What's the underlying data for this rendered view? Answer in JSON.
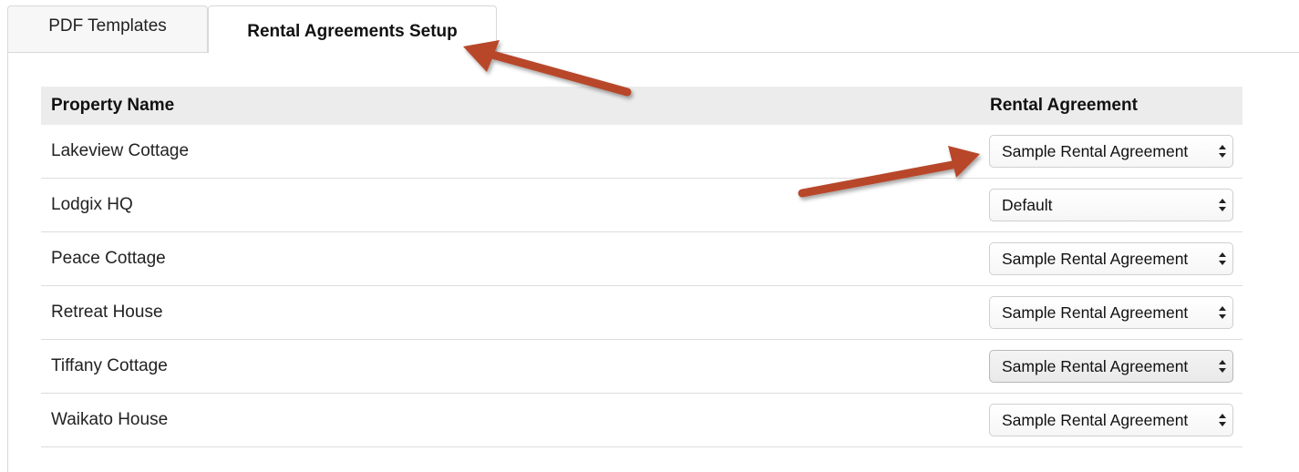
{
  "tabs": [
    {
      "label": "PDF Templates",
      "active": false
    },
    {
      "label": "Rental Agreements Setup",
      "active": true
    }
  ],
  "table": {
    "headers": {
      "property_name": "Property Name",
      "rental_agreement": "Rental Agreement"
    },
    "rows": [
      {
        "property": "Lakeview Cottage",
        "agreement": "Sample Rental Agreement"
      },
      {
        "property": "Lodgix HQ",
        "agreement": "Default"
      },
      {
        "property": "Peace Cottage",
        "agreement": "Sample Rental Agreement"
      },
      {
        "property": "Retreat House",
        "agreement": "Sample Rental Agreement"
      },
      {
        "property": "Tiffany Cottage",
        "agreement": "Sample Rental Agreement"
      },
      {
        "property": "Waikato House",
        "agreement": "Sample Rental Agreement"
      }
    ]
  },
  "annotations": {
    "arrow_color": "#b8462a",
    "arrows": [
      "pointing-to-rental-agreements-tab",
      "pointing-to-first-agreement-select"
    ]
  },
  "colors": {
    "header_bg": "#ececec",
    "border": "#d8d8d8"
  }
}
